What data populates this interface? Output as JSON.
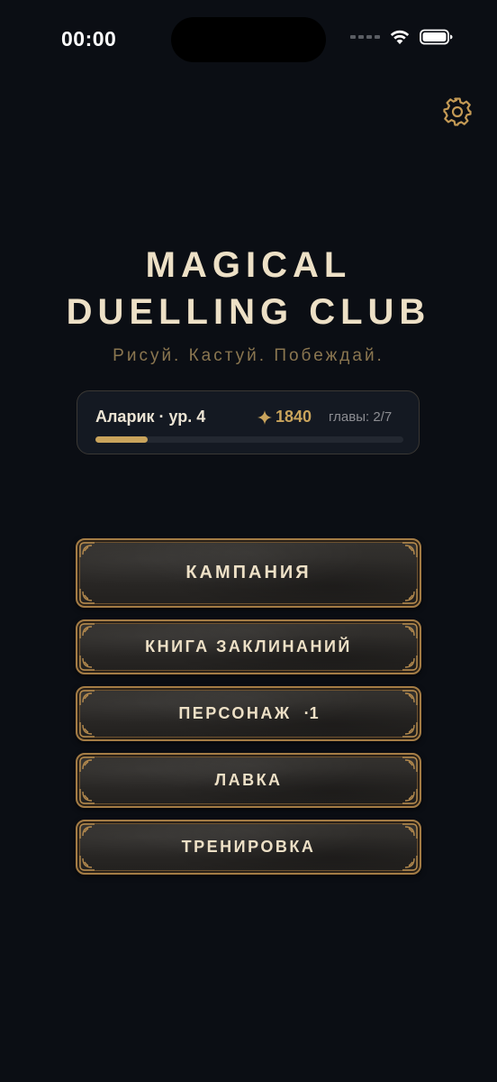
{
  "status_bar": {
    "time": "00:00"
  },
  "header": {
    "settings_icon": "gear-icon",
    "title_line1": "MAGICAL",
    "title_line2": "DUELLING CLUB",
    "subtitle": "Рисуй. Кастуй. Побеждай."
  },
  "player": {
    "name_level": "Аларик · ур. 4",
    "gold_icon": "sparkle-icon",
    "gold": "1840",
    "chapters": "главы: 2/7",
    "xp_progress": 0.17
  },
  "menu": {
    "campaign": "КАМПАНИЯ",
    "spellbook": "КНИГА ЗАКЛИНАНИЙ",
    "character": "ПЕРСОНАЖ",
    "character_badge": "·1",
    "shop": "ЛАВКА",
    "training": "ТРЕНИРОВКА"
  },
  "colors": {
    "background": "#0b0e14",
    "gold_accent": "#c9a45c",
    "title_text": "#ede0c6",
    "subtitle_text": "#8a7650"
  }
}
